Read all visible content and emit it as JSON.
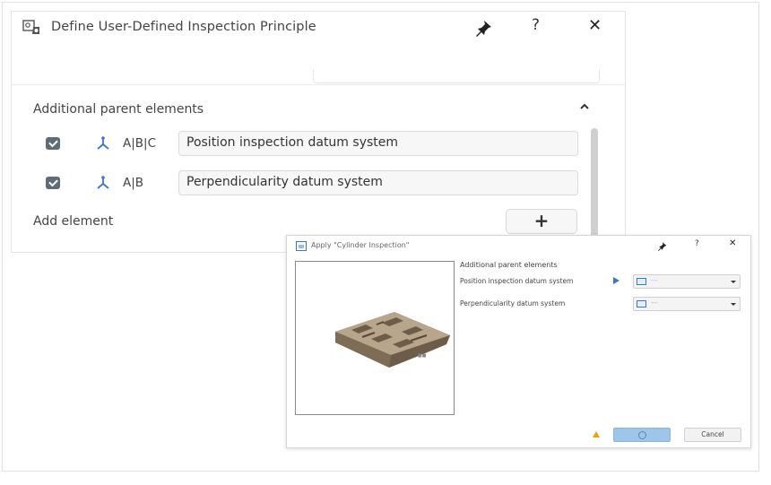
{
  "main_dialog": {
    "title": "Define User-Defined Inspection Principle",
    "help_glyph": "?",
    "close_glyph": "✕",
    "section_title": "Additional parent elements",
    "rows": [
      {
        "code": "A|B|C",
        "value": "Position inspection datum system"
      },
      {
        "code": "A|B",
        "value": "Perpendicularity datum system"
      }
    ],
    "add_label": "Add element",
    "add_button_glyph": "+"
  },
  "apply_dialog": {
    "title": "Apply \"Cylinder Inspection\"",
    "help_glyph": "?",
    "close_glyph": "✕",
    "section_title": "Additional parent elements",
    "rows": [
      {
        "label": "Position inspection datum system",
        "value": "---"
      },
      {
        "label": "Perpendicularity datum system",
        "value": "---"
      }
    ],
    "cancel_label": "Cancel"
  },
  "icons": {
    "title_icon": "dialog-settings-icon",
    "pin": "pin-icon",
    "datum": "datum-system-icon",
    "collapse": "chevron-up-icon",
    "warning": "warning-icon",
    "ok": "ok-icon"
  },
  "colors": {
    "accent_blue": "#3a78c4",
    "ok_button": "#9dc6ea",
    "warning": "#e3a21a",
    "checkbox": "#5f6b77"
  }
}
